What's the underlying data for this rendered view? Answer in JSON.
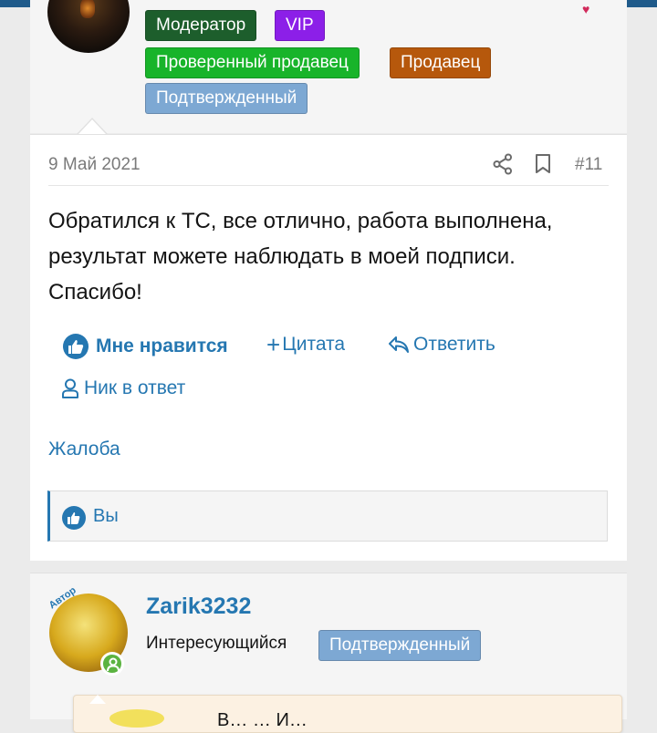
{
  "post1": {
    "badges": {
      "moderator": "Модератор",
      "vip": "VIP",
      "verified_seller": "Проверенный продавец",
      "seller": "Продавец",
      "confirmed": "Подтвержденный"
    },
    "date": "9 Май 2021",
    "post_number": "#11",
    "text": "Обратился к ТС, все отлично, работа выполнена, результат можете наблюдать в моей подписи. Спасибо!",
    "actions": {
      "like": "Мне нравится",
      "quote": "Цитата",
      "reply": "Ответить",
      "nick_reply": "Ник в ответ",
      "report": "Жалоба"
    },
    "reactions_label": "Вы"
  },
  "post2": {
    "author_ribbon": "Автор",
    "username": "Zarik3232",
    "user_title": "Интересующийся",
    "badge": "Подтвержденный",
    "quote_preview": "В… … И…"
  },
  "colors": {
    "link": "#2577b1",
    "moderator": "#1d5e2c",
    "vip": "#8c1fe8",
    "verified_seller": "#18b42a",
    "seller": "#b6580c",
    "confirmed": "#7da8d3"
  },
  "icons": [
    "share-icon",
    "bookmark-icon",
    "thumbs-up-icon",
    "plus-icon",
    "reply-icon",
    "user-icon",
    "online-icon",
    "heart-icon"
  ]
}
